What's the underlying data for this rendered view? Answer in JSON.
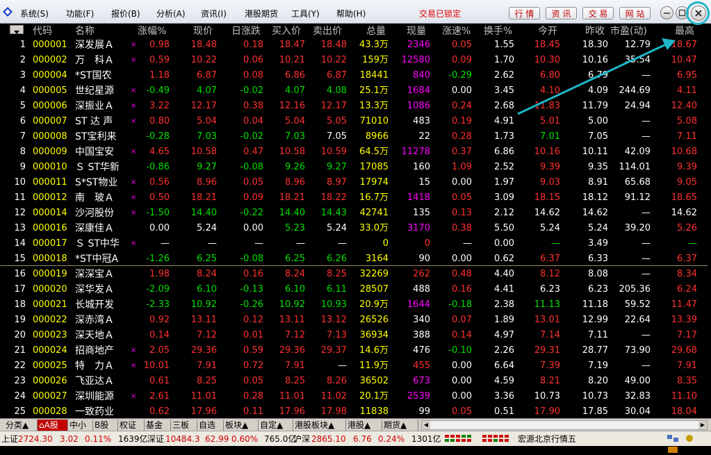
{
  "colors": {
    "up": "#ff3030",
    "down": "#00e000",
    "flat": "#ffffff",
    "yellow": "#ffff00",
    "magenta": "#ff00ff",
    "accent": "#1fb6c8"
  },
  "menu": {
    "items": [
      "系统(S)",
      "功能(F)",
      "报价(B)",
      "分析(A)",
      "资讯(I)",
      "港股期货",
      "工具(Y)",
      "帮助(H)"
    ],
    "lock_status": "交易已锁定",
    "buttons": [
      "行 情",
      "资 讯",
      "交 易",
      "网 站"
    ],
    "window_icons": [
      "minimize-icon",
      "maximize-icon",
      "close-icon"
    ]
  },
  "table": {
    "headers": [
      "代码",
      "名称",
      "涨幅%",
      "现价",
      "日涨跌",
      "买入价",
      "卖出价",
      "总量",
      "现量",
      "涨速%",
      "换手%",
      "今开",
      "昨收",
      "市盈(动)",
      "最高"
    ],
    "rows": [
      {
        "i": "1",
        "code": "000001",
        "name": "深发展Ａ",
        "mark": "×",
        "chg": "0.98",
        "price": "18.48",
        "d": "0.18",
        "buy": "18.47",
        "sell": "18.48",
        "vol": "43.3万",
        "cur": "2346",
        "spd": "0.05",
        "turn": "1.55",
        "open": "18.45",
        "close": "18.30",
        "pe": "12.79",
        "high": "18.67",
        "t": "u",
        "spdt": "u",
        "curt": "m",
        "opent": "u",
        "hight": "u"
      },
      {
        "i": "2",
        "code": "000002",
        "name": "万　科Ａ",
        "mark": "×",
        "chg": "0.59",
        "price": "10.22",
        "d": "0.06",
        "buy": "10.21",
        "sell": "10.22",
        "vol": "159万",
        "cur": "12580",
        "spd": "0.09",
        "turn": "1.70",
        "open": "10.30",
        "close": "10.16",
        "pe": "35.54",
        "high": "10.47",
        "t": "u",
        "spdt": "u",
        "curt": "m",
        "opent": "u",
        "hight": "u"
      },
      {
        "i": "3",
        "code": "000004",
        "name": "*ST国农",
        "mark": "",
        "chg": "1.18",
        "price": "6.87",
        "d": "0.08",
        "buy": "6.86",
        "sell": "6.87",
        "vol": "18441",
        "cur": "840",
        "spd": "-0.29",
        "turn": "2.62",
        "open": "6.80",
        "close": "6.79",
        "pe": "—",
        "high": "6.95",
        "t": "u",
        "spdt": "d",
        "curt": "m",
        "opent": "u",
        "hight": "u"
      },
      {
        "i": "4",
        "code": "000005",
        "name": "世纪星源",
        "mark": "×",
        "chg": "-0.49",
        "price": "4.07",
        "d": "-0.02",
        "buy": "4.07",
        "sell": "4.08",
        "vol": "25.1万",
        "cur": "1684",
        "spd": "0.00",
        "turn": "3.45",
        "open": "4.10",
        "close": "4.09",
        "pe": "244.69",
        "high": "4.11",
        "t": "d",
        "spdt": "f",
        "curt": "m",
        "opent": "u",
        "hight": "u"
      },
      {
        "i": "5",
        "code": "000006",
        "name": "深振业Ａ",
        "mark": "×",
        "chg": "3.22",
        "price": "12.17",
        "d": "0.38",
        "buy": "12.16",
        "sell": "12.17",
        "vol": "13.3万",
        "cur": "1086",
        "spd": "0.24",
        "turn": "2.68",
        "open": "11.83",
        "close": "11.79",
        "pe": "24.94",
        "high": "12.40",
        "t": "u",
        "spdt": "u",
        "curt": "m",
        "opent": "u",
        "hight": "u"
      },
      {
        "i": "6",
        "code": "000007",
        "name": "ST 达 声",
        "mark": "×",
        "chg": "0.80",
        "price": "5.04",
        "d": "0.04",
        "buy": "5.04",
        "sell": "5.05",
        "vol": "71010",
        "cur": "483",
        "spd": "0.19",
        "turn": "4.91",
        "open": "5.01",
        "close": "5.00",
        "pe": "—",
        "high": "5.08",
        "t": "u",
        "spdt": "u",
        "curt": "f",
        "opent": "u",
        "hight": "u"
      },
      {
        "i": "7",
        "code": "000008",
        "name": "ST宝利来",
        "mark": "",
        "chg": "-0.28",
        "price": "7.03",
        "d": "-0.02",
        "buy": "7.03",
        "sell": "7.05",
        "vol": "8966",
        "cur": "22",
        "spd": "0.28",
        "turn": "1.73",
        "open": "7.01",
        "close": "7.05",
        "pe": "—",
        "high": "7.11",
        "t": "d",
        "spdt": "u",
        "curt": "f",
        "opent": "d",
        "hight": "u",
        "sellt": "f"
      },
      {
        "i": "8",
        "code": "000009",
        "name": "中国宝安",
        "mark": "×",
        "chg": "4.65",
        "price": "10.58",
        "d": "0.47",
        "buy": "10.58",
        "sell": "10.59",
        "vol": "64.5万",
        "cur": "11278",
        "spd": "0.37",
        "turn": "6.86",
        "open": "10.16",
        "close": "10.11",
        "pe": "42.09",
        "high": "10.68",
        "t": "u",
        "spdt": "u",
        "curt": "m",
        "opent": "u",
        "hight": "u"
      },
      {
        "i": "9",
        "code": "000010",
        "name": "Ｓ ST华新",
        "mark": "",
        "chg": "-0.86",
        "price": "9.27",
        "d": "-0.08",
        "buy": "9.26",
        "sell": "9.27",
        "vol": "17085",
        "cur": "160",
        "spd": "1.09",
        "turn": "2.52",
        "open": "9.39",
        "close": "9.35",
        "pe": "114.01",
        "high": "9.39",
        "t": "d",
        "spdt": "u",
        "curt": "f",
        "opent": "u",
        "hight": "u"
      },
      {
        "i": "10",
        "code": "000011",
        "name": "S*ST物业",
        "mark": "×",
        "chg": "0.56",
        "price": "8.96",
        "d": "0.05",
        "buy": "8.96",
        "sell": "8.97",
        "vol": "17974",
        "cur": "15",
        "spd": "0.00",
        "turn": "1.97",
        "open": "9.03",
        "close": "8.91",
        "pe": "65.68",
        "high": "9.05",
        "t": "u",
        "spdt": "f",
        "curt": "f",
        "opent": "u",
        "hight": "u"
      },
      {
        "i": "11",
        "code": "000012",
        "name": "南　玻Ａ",
        "mark": "×",
        "chg": "0.50",
        "price": "18.21",
        "d": "0.09",
        "buy": "18.21",
        "sell": "18.22",
        "vol": "16.7万",
        "cur": "1418",
        "spd": "0.05",
        "turn": "3.09",
        "open": "18.15",
        "close": "18.12",
        "pe": "91.12",
        "high": "18.65",
        "t": "u",
        "spdt": "u",
        "curt": "m",
        "opent": "u",
        "hight": "u"
      },
      {
        "i": "12",
        "code": "000014",
        "name": "沙河股份",
        "mark": "×",
        "chg": "-1.50",
        "price": "14.40",
        "d": "-0.22",
        "buy": "14.40",
        "sell": "14.43",
        "vol": "42741",
        "cur": "135",
        "spd": "0.13",
        "turn": "2.12",
        "open": "14.62",
        "close": "14.62",
        "pe": "—",
        "high": "14.62",
        "t": "d",
        "spdt": "u",
        "curt": "f",
        "opent": "f",
        "hight": "f"
      },
      {
        "i": "13",
        "code": "000016",
        "name": "深康佳Ａ",
        "mark": "",
        "chg": "0.00",
        "price": "5.24",
        "d": "0.00",
        "buy": "5.23",
        "sell": "5.24",
        "vol": "33.0万",
        "cur": "3170",
        "spd": "0.38",
        "turn": "5.50",
        "open": "5.24",
        "close": "5.24",
        "pe": "39.20",
        "high": "5.26",
        "t": "f",
        "spdt": "u",
        "curt": "m",
        "opent": "f",
        "hight": "u",
        "buyt": "d"
      },
      {
        "i": "14",
        "code": "000017",
        "name": "Ｓ ST中华",
        "mark": "×",
        "chg": "—",
        "price": "—",
        "d": "—",
        "buy": "—",
        "sell": "—",
        "vol": "0",
        "cur": "0",
        "spd": "—",
        "turn": "0.00",
        "open": "—",
        "close": "3.49",
        "pe": "—",
        "high": "—",
        "t": "f",
        "spdt": "f",
        "curt": "u",
        "opent": "d",
        "hight": "d"
      },
      {
        "i": "15",
        "code": "000018",
        "name": "*ST中冠A",
        "mark": "",
        "chg": "-1.26",
        "price": "6.25",
        "d": "-0.08",
        "buy": "6.25",
        "sell": "6.26",
        "vol": "3164",
        "cur": "90",
        "spd": "0.00",
        "turn": "0.62",
        "open": "6.37",
        "close": "6.33",
        "pe": "—",
        "high": "6.37",
        "t": "d",
        "spdt": "f",
        "curt": "f",
        "opent": "u",
        "hight": "u"
      },
      {
        "i": "16",
        "code": "000019",
        "name": "深深宝Ａ",
        "mark": "",
        "chg": "1.98",
        "price": "8.24",
        "d": "0.16",
        "buy": "8.24",
        "sell": "8.25",
        "vol": "32269",
        "cur": "262",
        "spd": "0.48",
        "turn": "4.40",
        "open": "8.12",
        "close": "8.08",
        "pe": "—",
        "high": "8.34",
        "t": "u",
        "spdt": "u",
        "curt": "u",
        "opent": "u",
        "hight": "u"
      },
      {
        "i": "17",
        "code": "000020",
        "name": "深华发Ａ",
        "mark": "",
        "chg": "-2.09",
        "price": "6.10",
        "d": "-0.13",
        "buy": "6.10",
        "sell": "6.11",
        "vol": "28507",
        "cur": "488",
        "spd": "0.16",
        "turn": "4.41",
        "open": "6.23",
        "close": "6.23",
        "pe": "205.36",
        "high": "6.24",
        "t": "d",
        "spdt": "u",
        "curt": "f",
        "opent": "f",
        "hight": "u"
      },
      {
        "i": "18",
        "code": "000021",
        "name": "长城开发",
        "mark": "",
        "chg": "-2.33",
        "price": "10.92",
        "d": "-0.26",
        "buy": "10.92",
        "sell": "10.93",
        "vol": "20.9万",
        "cur": "1644",
        "spd": "-0.18",
        "turn": "2.38",
        "open": "11.13",
        "close": "11.18",
        "pe": "59.52",
        "high": "11.47",
        "t": "d",
        "spdt": "d",
        "curt": "m",
        "opent": "d",
        "hight": "u"
      },
      {
        "i": "19",
        "code": "000022",
        "name": "深赤湾Ａ",
        "mark": "",
        "chg": "0.92",
        "price": "13.11",
        "d": "0.12",
        "buy": "13.11",
        "sell": "13.12",
        "vol": "26526",
        "cur": "340",
        "spd": "0.07",
        "turn": "1.89",
        "open": "13.01",
        "close": "12.99",
        "pe": "22.64",
        "high": "13.39",
        "t": "u",
        "spdt": "u",
        "curt": "f",
        "opent": "u",
        "hight": "u"
      },
      {
        "i": "20",
        "code": "000023",
        "name": "深天地Ａ",
        "mark": "",
        "chg": "0.14",
        "price": "7.12",
        "d": "0.01",
        "buy": "7.12",
        "sell": "7.13",
        "vol": "36934",
        "cur": "388",
        "spd": "0.14",
        "turn": "4.97",
        "open": "7.14",
        "close": "7.11",
        "pe": "—",
        "high": "7.17",
        "t": "u",
        "spdt": "u",
        "curt": "f",
        "opent": "u",
        "hight": "u"
      },
      {
        "i": "21",
        "code": "000024",
        "name": "招商地产",
        "mark": "×",
        "chg": "2.05",
        "price": "29.36",
        "d": "0.59",
        "buy": "29.36",
        "sell": "29.37",
        "vol": "14.6万",
        "cur": "476",
        "spd": "-0.10",
        "turn": "2.26",
        "open": "29.31",
        "close": "28.77",
        "pe": "73.90",
        "high": "29.68",
        "t": "u",
        "spdt": "d",
        "curt": "f",
        "opent": "u",
        "hight": "u"
      },
      {
        "i": "22",
        "code": "000025",
        "name": "特　力Ａ",
        "mark": "×",
        "chg": "10.01",
        "price": "7.91",
        "d": "0.72",
        "buy": "7.91",
        "sell": "—",
        "vol": "11.9万",
        "cur": "455",
        "spd": "0.00",
        "turn": "6.64",
        "open": "7.39",
        "close": "7.19",
        "pe": "—",
        "high": "7.91",
        "t": "u",
        "spdt": "f",
        "curt": "u",
        "opent": "u",
        "hight": "u",
        "sellt": "f"
      },
      {
        "i": "23",
        "code": "000026",
        "name": "飞亚达Ａ",
        "mark": "",
        "chg": "0.61",
        "price": "8.25",
        "d": "0.05",
        "buy": "8.25",
        "sell": "8.26",
        "vol": "36502",
        "cur": "673",
        "spd": "0.00",
        "turn": "4.59",
        "open": "8.21",
        "close": "8.20",
        "pe": "49.00",
        "high": "8.35",
        "t": "u",
        "spdt": "f",
        "curt": "m",
        "opent": "u",
        "hight": "u"
      },
      {
        "i": "24",
        "code": "000027",
        "name": "深圳能源",
        "mark": "×",
        "chg": "2.61",
        "price": "11.01",
        "d": "0.28",
        "buy": "11.01",
        "sell": "11.02",
        "vol": "20.1万",
        "cur": "2539",
        "spd": "0.00",
        "turn": "3.36",
        "open": "10.73",
        "close": "10.73",
        "pe": "32.83",
        "high": "11.10",
        "t": "u",
        "spdt": "f",
        "curt": "m",
        "opent": "f",
        "hight": "u"
      },
      {
        "i": "25",
        "code": "000028",
        "name": "一致药业",
        "mark": "",
        "chg": "0.62",
        "price": "17.96",
        "d": "0.11",
        "buy": "17.96",
        "sell": "17.98",
        "vol": "11838",
        "cur": "99",
        "spd": "0.05",
        "turn": "0.51",
        "open": "17.90",
        "close": "17.85",
        "pe": "30.04",
        "high": "18.04",
        "t": "u",
        "spdt": "u",
        "curt": "f",
        "opent": "u",
        "hight": "u"
      }
    ]
  },
  "tabs": [
    "分类▲",
    "A股",
    "中小",
    "B股",
    "权证",
    "基金",
    "三板",
    "自选",
    "板块▲",
    "自定▲",
    "港股板块▲",
    "港股▲",
    "期货▲"
  ],
  "status": {
    "sh_label": "上证",
    "sh_value": "2724.30",
    "sh_change": "3.02",
    "sh_pct": "0.11%",
    "sh_amount": "1639亿",
    "sz_label": "深证",
    "sz_value": "10484.3",
    "sz_change": "62.99",
    "sz_pct": "0.60%",
    "sz_amount": "765.0亿",
    "hs_label": "沪深",
    "hs_value": "2865.10",
    "hs_change": "6.76",
    "hs_pct": "0.24%",
    "hs_amount": "1301亿",
    "feed": "宏源北京行情五"
  }
}
